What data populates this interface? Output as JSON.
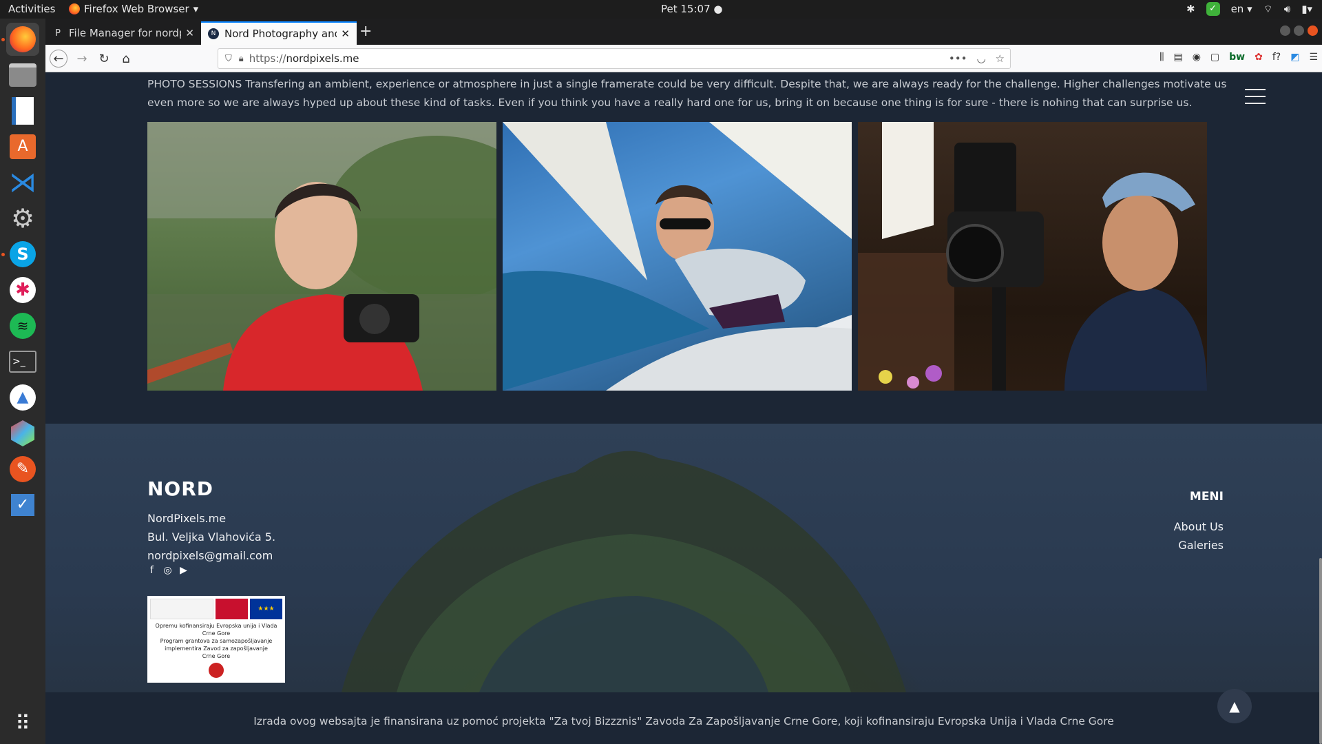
{
  "topbar": {
    "activities": "Activities",
    "app_name": "Firefox Web Browser",
    "clock": "Pet 15:07",
    "lang": "en"
  },
  "dock": {
    "items": [
      "firefox",
      "files",
      "writer",
      "software-center",
      "vscode",
      "settings",
      "skype",
      "slack",
      "spotify",
      "terminal",
      "android-studio",
      "bundle",
      "draw",
      "todo",
      "apps-grid"
    ]
  },
  "browser": {
    "tabs": [
      {
        "title": "File Manager for nordpixels",
        "favicon": "P"
      },
      {
        "title": "Nord Photography and Video",
        "favicon": "N"
      }
    ],
    "url_scheme": "https://",
    "url_host": "nordpixels.me"
  },
  "page": {
    "intro": "PHOTO SESSIONS Transfering an ambient, experience or atmosphere in just a single framerate could be very difficult. Despite that, we are always ready for the challenge. Higher challenges motivate us even more so we are always hyped up about these kind of tasks. Even if you think you have a really hard one for us, bring it on because one thing is for sure - there is nohing that can surprise us.",
    "footer": {
      "logo": "NORD",
      "site": "NordPixels.me",
      "address": "Bul. Veljka Vlahovića 5.",
      "email": "nordpixels@gmail.com",
      "badge_line1": "Opremu kofinansiraju Evropska unija i Vlada Crne Gore",
      "badge_line2": "Program grantova za samozapošljavanje",
      "badge_line3": "implementira Zavod za zapošljavanje",
      "badge_line4": "Crne Gore",
      "menu_title": "MENI",
      "menu_items": [
        "About Us",
        "Galeries"
      ]
    },
    "copyright": "Izrada ovog websajta je finansirana uz pomoć projekta \"Za tvoj Bizzznis\" Zavoda Za Zapošljavanje Crne Gore, koji kofinansiraju Evropska Unija i Vlada Crne Gore"
  }
}
